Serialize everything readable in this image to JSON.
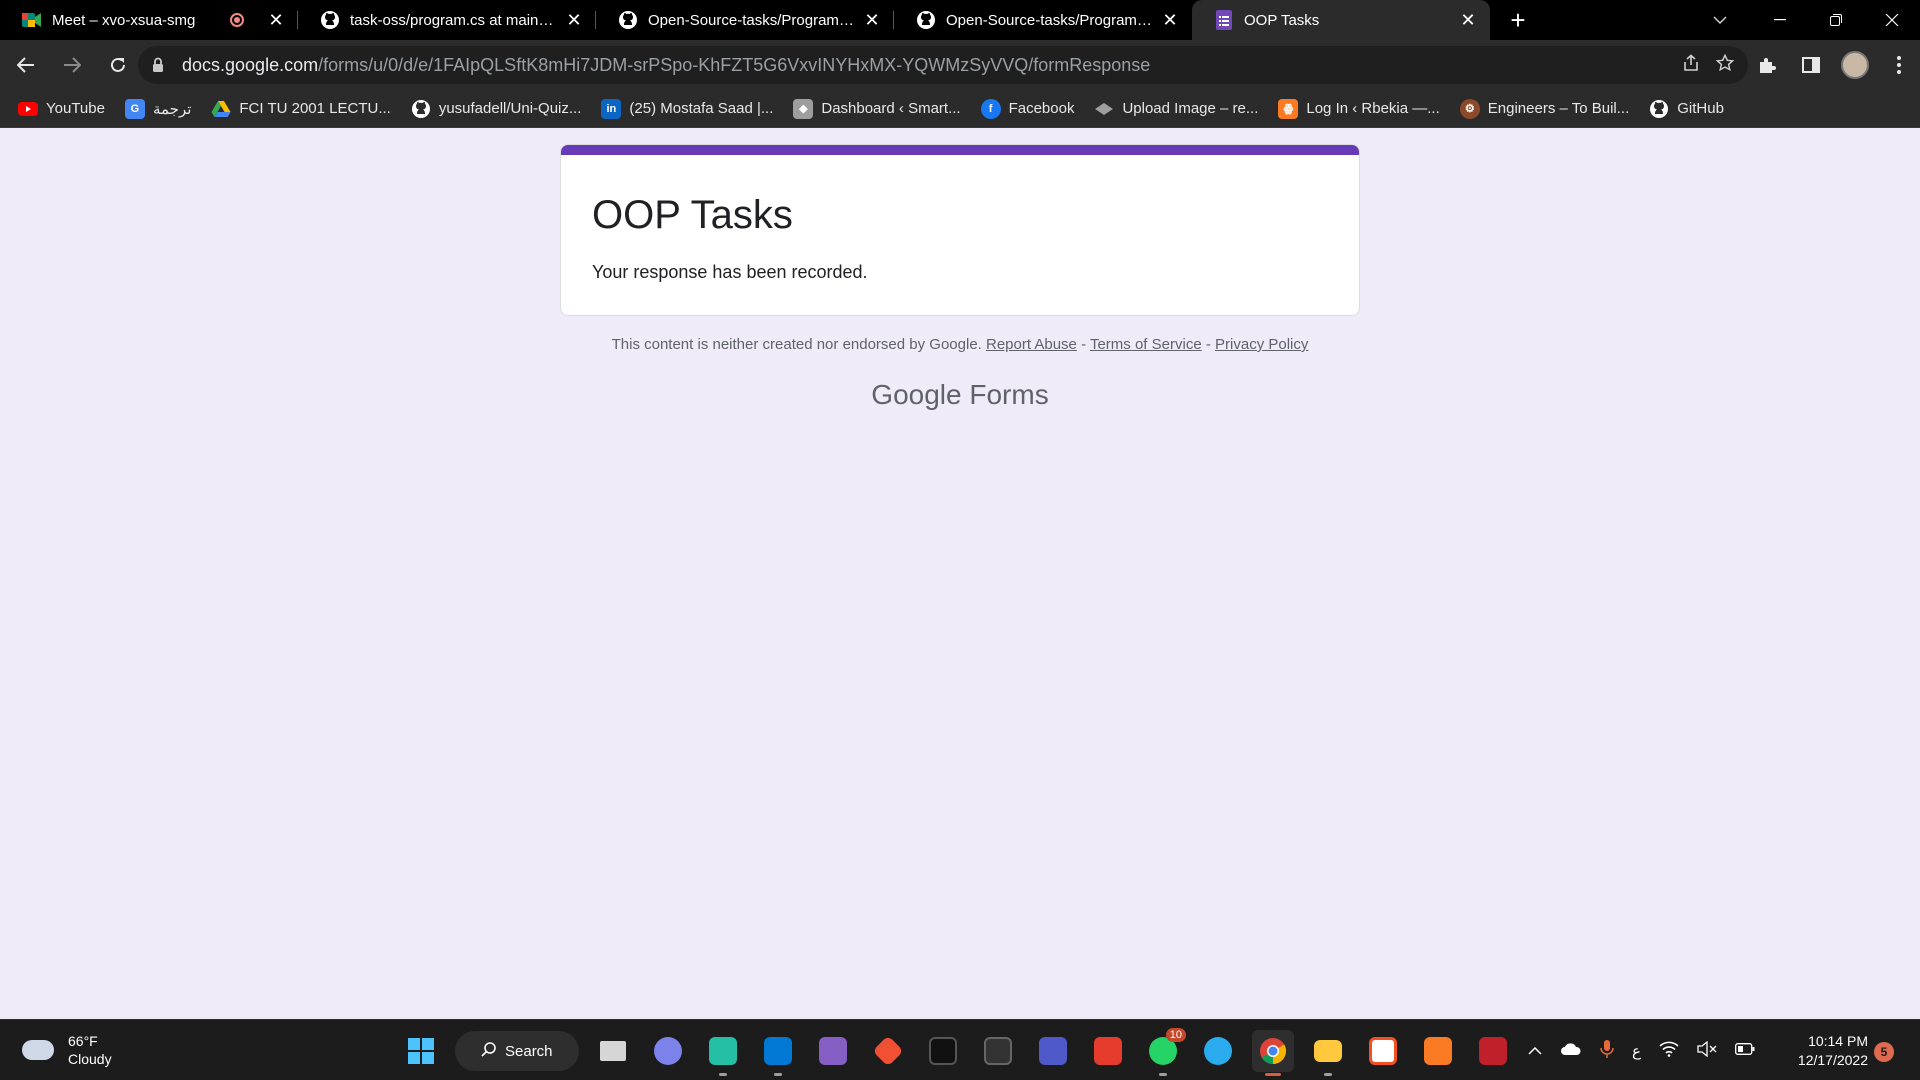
{
  "browser": {
    "tabs": [
      {
        "title": "Meet – xvo-xsua-smg",
        "recording": true,
        "icon": "meet-icon",
        "icon_color": "#00897b"
      },
      {
        "title": "task-oss/program.cs at main · mo",
        "icon": "github-icon"
      },
      {
        "title": "Open-Source-tasks/Program.cs a",
        "icon": "github-icon"
      },
      {
        "title": "Open-Source-tasks/Program.cs a",
        "icon": "github-icon"
      },
      {
        "title": "OOP Tasks",
        "icon": "forms-icon",
        "icon_color": "#7248b9",
        "active": true
      }
    ],
    "new_tab_symbol": "+",
    "address": {
      "host": "docs.google.com",
      "path": "/forms/u/0/d/e/1FAIpQLSftK8mHi7JDM-srPSpo-KhFZT5G6VxvINYHxMX-YQWMzSyVVQ/formResponse"
    },
    "bookmarks": [
      {
        "label": "YouTube",
        "icon": "youtube-icon",
        "color": "#ff0000"
      },
      {
        "label": "ترجمة",
        "icon": "translate-icon",
        "color": "#4285f4"
      },
      {
        "label": "FCI TU 2001 LECTU...",
        "icon": "drive-icon",
        "color": "#fbbc04"
      },
      {
        "label": "yusufadell/Uni-Quiz...",
        "icon": "github-icon",
        "color": "#ffffff"
      },
      {
        "label": "(25) Mostafa Saad |...",
        "icon": "linkedin-icon",
        "color": "#0a66c2"
      },
      {
        "label": "Dashboard ‹ Smart...",
        "icon": "site-icon",
        "color": "#9e9e9e"
      },
      {
        "label": "Facebook",
        "icon": "facebook-icon",
        "color": "#1877f2"
      },
      {
        "label": "Upload Image – re...",
        "icon": "upload-icon",
        "color": "#9e9e9e"
      },
      {
        "label": "Log In ‹ Rbekia —...",
        "icon": "xampp-icon",
        "color": "#fb7a24"
      },
      {
        "label": "Engineers – To Buil...",
        "icon": "engineers-icon",
        "color": "#8d4a2a"
      },
      {
        "label": "GitHub",
        "icon": "github-icon",
        "color": "#ffffff"
      }
    ]
  },
  "form": {
    "title": "OOP Tasks",
    "message": "Your response has been recorded.",
    "accent_color": "#673ab7",
    "disclaimer": "This content is neither created nor endorsed by Google.",
    "links": {
      "report": "Report Abuse",
      "terms": "Terms of Service",
      "privacy": "Privacy Policy"
    },
    "separator": " - ",
    "brand_google": "Google",
    "brand_forms": "Forms"
  },
  "taskbar": {
    "weather": {
      "temp": "66°F",
      "condition": "Cloudy"
    },
    "search_label": "Search",
    "whatsapp_badge": "10",
    "time": "10:14 PM",
    "date": "12/17/2022",
    "notifications": "5",
    "language": "ع"
  }
}
